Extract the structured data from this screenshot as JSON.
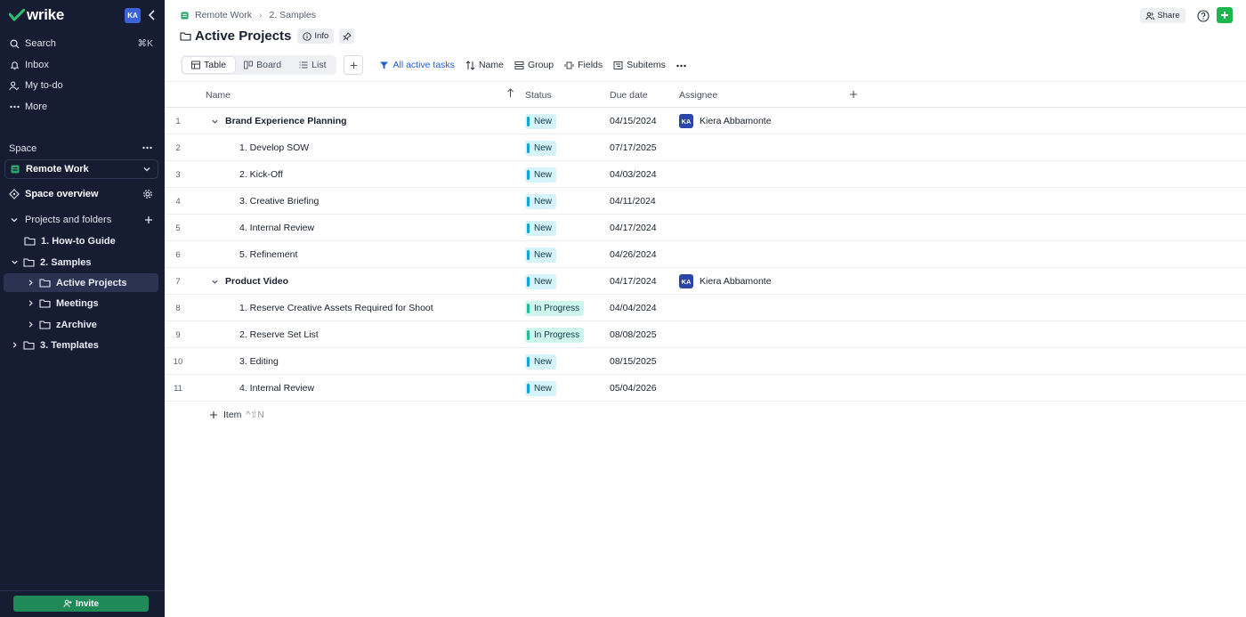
{
  "app": {
    "brand": "wrike",
    "user_initials": "KA"
  },
  "sidebar": {
    "nav": [
      {
        "label": "Search",
        "icon": "search-icon",
        "shortcut": "⌘K"
      },
      {
        "label": "Inbox",
        "icon": "bell-icon"
      },
      {
        "label": "My to-do",
        "icon": "person-check-icon"
      },
      {
        "label": "More",
        "icon": "more-horizontal-icon"
      }
    ],
    "space_label": "Space",
    "space_selected": "Remote Work",
    "space_overview": "Space overview",
    "projects_label": "Projects and folders",
    "tree": [
      {
        "label": "1. How-to Guide"
      },
      {
        "label": "2. Samples"
      },
      {
        "label": "Active Projects"
      },
      {
        "label": "Meetings"
      },
      {
        "label": "zArchive"
      },
      {
        "label": "3. Templates"
      }
    ],
    "invite_label": "Invite"
  },
  "header": {
    "breadcrumb": [
      "Remote Work",
      "2. Samples"
    ],
    "share_label": "Share",
    "title": "Active Projects",
    "info_label": "Info"
  },
  "toolbar": {
    "views": [
      "Table",
      "Board",
      "List"
    ],
    "filter_label": "All active tasks",
    "sort_label": "Name",
    "group_label": "Group",
    "fields_label": "Fields",
    "subitems_label": "Subitems"
  },
  "table": {
    "columns": [
      "Name",
      "Status",
      "Due date",
      "Assignee"
    ],
    "rows": [
      {
        "num": "1",
        "name": "Brand Experience Planning",
        "status": "New",
        "due": "04/15/2024",
        "assignee": "Kiera Abbamonte",
        "assignee_initials": "KA"
      },
      {
        "num": "2",
        "name": "1. Develop SOW",
        "status": "New",
        "due": "07/17/2025"
      },
      {
        "num": "3",
        "name": "2. Kick-Off",
        "status": "New",
        "due": "04/03/2024"
      },
      {
        "num": "4",
        "name": "3. Creative Briefing",
        "status": "New",
        "due": "04/11/2024"
      },
      {
        "num": "5",
        "name": "4. Internal Review",
        "status": "New",
        "due": "04/17/2024"
      },
      {
        "num": "6",
        "name": "5. Refinement",
        "status": "New",
        "due": "04/26/2024"
      },
      {
        "num": "7",
        "name": "Product Video",
        "status": "New",
        "due": "04/17/2024",
        "assignee": "Kiera Abbamonte",
        "assignee_initials": "KA"
      },
      {
        "num": "8",
        "name": "1. Reserve Creative Assets Required for Shoot",
        "status": "In Progress",
        "due": "04/04/2024"
      },
      {
        "num": "9",
        "name": "2. Reserve Set List",
        "status": "In Progress",
        "due": "08/08/2025"
      },
      {
        "num": "10",
        "name": "3. Editing",
        "status": "New",
        "due": "08/15/2025"
      },
      {
        "num": "11",
        "name": "4. Internal Review",
        "status": "New",
        "due": "05/04/2026"
      }
    ],
    "add_item_label": "Item",
    "add_item_shortcut": "^⇧N"
  },
  "colors": {
    "sidebar_bg": "#161d33",
    "accent_green": "#1cb64d",
    "link_blue": "#1d5fd1",
    "status_new": "#12a4d4",
    "status_in_progress": "#1fbf95"
  }
}
